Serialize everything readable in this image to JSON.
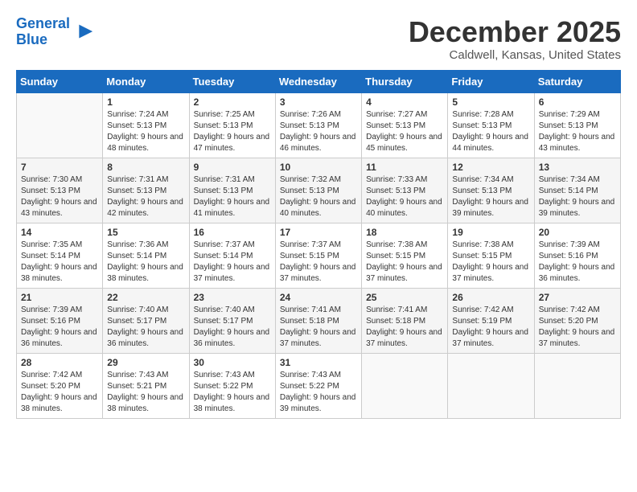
{
  "logo": {
    "line1": "General",
    "line2": "Blue"
  },
  "title": "December 2025",
  "location": "Caldwell, Kansas, United States",
  "weekdays": [
    "Sunday",
    "Monday",
    "Tuesday",
    "Wednesday",
    "Thursday",
    "Friday",
    "Saturday"
  ],
  "weeks": [
    [
      {
        "day": "",
        "sunrise": "",
        "sunset": "",
        "daylight": ""
      },
      {
        "day": "1",
        "sunrise": "Sunrise: 7:24 AM",
        "sunset": "Sunset: 5:13 PM",
        "daylight": "Daylight: 9 hours and 48 minutes."
      },
      {
        "day": "2",
        "sunrise": "Sunrise: 7:25 AM",
        "sunset": "Sunset: 5:13 PM",
        "daylight": "Daylight: 9 hours and 47 minutes."
      },
      {
        "day": "3",
        "sunrise": "Sunrise: 7:26 AM",
        "sunset": "Sunset: 5:13 PM",
        "daylight": "Daylight: 9 hours and 46 minutes."
      },
      {
        "day": "4",
        "sunrise": "Sunrise: 7:27 AM",
        "sunset": "Sunset: 5:13 PM",
        "daylight": "Daylight: 9 hours and 45 minutes."
      },
      {
        "day": "5",
        "sunrise": "Sunrise: 7:28 AM",
        "sunset": "Sunset: 5:13 PM",
        "daylight": "Daylight: 9 hours and 44 minutes."
      },
      {
        "day": "6",
        "sunrise": "Sunrise: 7:29 AM",
        "sunset": "Sunset: 5:13 PM",
        "daylight": "Daylight: 9 hours and 43 minutes."
      }
    ],
    [
      {
        "day": "7",
        "sunrise": "Sunrise: 7:30 AM",
        "sunset": "Sunset: 5:13 PM",
        "daylight": "Daylight: 9 hours and 43 minutes."
      },
      {
        "day": "8",
        "sunrise": "Sunrise: 7:31 AM",
        "sunset": "Sunset: 5:13 PM",
        "daylight": "Daylight: 9 hours and 42 minutes."
      },
      {
        "day": "9",
        "sunrise": "Sunrise: 7:31 AM",
        "sunset": "Sunset: 5:13 PM",
        "daylight": "Daylight: 9 hours and 41 minutes."
      },
      {
        "day": "10",
        "sunrise": "Sunrise: 7:32 AM",
        "sunset": "Sunset: 5:13 PM",
        "daylight": "Daylight: 9 hours and 40 minutes."
      },
      {
        "day": "11",
        "sunrise": "Sunrise: 7:33 AM",
        "sunset": "Sunset: 5:13 PM",
        "daylight": "Daylight: 9 hours and 40 minutes."
      },
      {
        "day": "12",
        "sunrise": "Sunrise: 7:34 AM",
        "sunset": "Sunset: 5:13 PM",
        "daylight": "Daylight: 9 hours and 39 minutes."
      },
      {
        "day": "13",
        "sunrise": "Sunrise: 7:34 AM",
        "sunset": "Sunset: 5:14 PM",
        "daylight": "Daylight: 9 hours and 39 minutes."
      }
    ],
    [
      {
        "day": "14",
        "sunrise": "Sunrise: 7:35 AM",
        "sunset": "Sunset: 5:14 PM",
        "daylight": "Daylight: 9 hours and 38 minutes."
      },
      {
        "day": "15",
        "sunrise": "Sunrise: 7:36 AM",
        "sunset": "Sunset: 5:14 PM",
        "daylight": "Daylight: 9 hours and 38 minutes."
      },
      {
        "day": "16",
        "sunrise": "Sunrise: 7:37 AM",
        "sunset": "Sunset: 5:14 PM",
        "daylight": "Daylight: 9 hours and 37 minutes."
      },
      {
        "day": "17",
        "sunrise": "Sunrise: 7:37 AM",
        "sunset": "Sunset: 5:15 PM",
        "daylight": "Daylight: 9 hours and 37 minutes."
      },
      {
        "day": "18",
        "sunrise": "Sunrise: 7:38 AM",
        "sunset": "Sunset: 5:15 PM",
        "daylight": "Daylight: 9 hours and 37 minutes."
      },
      {
        "day": "19",
        "sunrise": "Sunrise: 7:38 AM",
        "sunset": "Sunset: 5:15 PM",
        "daylight": "Daylight: 9 hours and 37 minutes."
      },
      {
        "day": "20",
        "sunrise": "Sunrise: 7:39 AM",
        "sunset": "Sunset: 5:16 PM",
        "daylight": "Daylight: 9 hours and 36 minutes."
      }
    ],
    [
      {
        "day": "21",
        "sunrise": "Sunrise: 7:39 AM",
        "sunset": "Sunset: 5:16 PM",
        "daylight": "Daylight: 9 hours and 36 minutes."
      },
      {
        "day": "22",
        "sunrise": "Sunrise: 7:40 AM",
        "sunset": "Sunset: 5:17 PM",
        "daylight": "Daylight: 9 hours and 36 minutes."
      },
      {
        "day": "23",
        "sunrise": "Sunrise: 7:40 AM",
        "sunset": "Sunset: 5:17 PM",
        "daylight": "Daylight: 9 hours and 36 minutes."
      },
      {
        "day": "24",
        "sunrise": "Sunrise: 7:41 AM",
        "sunset": "Sunset: 5:18 PM",
        "daylight": "Daylight: 9 hours and 37 minutes."
      },
      {
        "day": "25",
        "sunrise": "Sunrise: 7:41 AM",
        "sunset": "Sunset: 5:18 PM",
        "daylight": "Daylight: 9 hours and 37 minutes."
      },
      {
        "day": "26",
        "sunrise": "Sunrise: 7:42 AM",
        "sunset": "Sunset: 5:19 PM",
        "daylight": "Daylight: 9 hours and 37 minutes."
      },
      {
        "day": "27",
        "sunrise": "Sunrise: 7:42 AM",
        "sunset": "Sunset: 5:20 PM",
        "daylight": "Daylight: 9 hours and 37 minutes."
      }
    ],
    [
      {
        "day": "28",
        "sunrise": "Sunrise: 7:42 AM",
        "sunset": "Sunset: 5:20 PM",
        "daylight": "Daylight: 9 hours and 38 minutes."
      },
      {
        "day": "29",
        "sunrise": "Sunrise: 7:43 AM",
        "sunset": "Sunset: 5:21 PM",
        "daylight": "Daylight: 9 hours and 38 minutes."
      },
      {
        "day": "30",
        "sunrise": "Sunrise: 7:43 AM",
        "sunset": "Sunset: 5:22 PM",
        "daylight": "Daylight: 9 hours and 38 minutes."
      },
      {
        "day": "31",
        "sunrise": "Sunrise: 7:43 AM",
        "sunset": "Sunset: 5:22 PM",
        "daylight": "Daylight: 9 hours and 39 minutes."
      },
      {
        "day": "",
        "sunrise": "",
        "sunset": "",
        "daylight": ""
      },
      {
        "day": "",
        "sunrise": "",
        "sunset": "",
        "daylight": ""
      },
      {
        "day": "",
        "sunrise": "",
        "sunset": "",
        "daylight": ""
      }
    ]
  ]
}
